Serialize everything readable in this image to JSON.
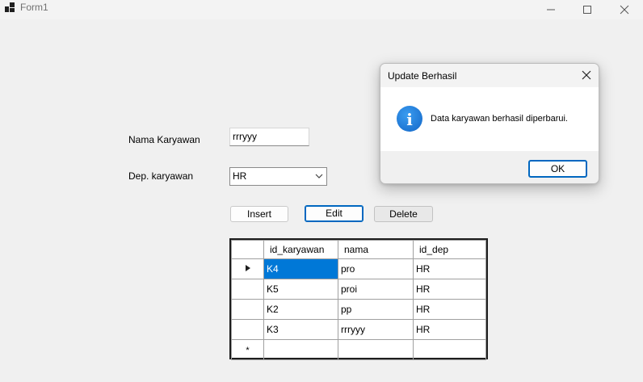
{
  "window": {
    "title": "Form1"
  },
  "form": {
    "nama_label": "Nama Karyawan",
    "nama_value": "rrryyy",
    "dep_label": "Dep. karyawan",
    "dep_value": "HR",
    "insert_label": "Insert",
    "edit_label": "Edit",
    "delete_label": "Delete"
  },
  "grid": {
    "columns": [
      "id_karyawan",
      "nama",
      "id_dep"
    ],
    "rows": [
      {
        "id_karyawan": "K4",
        "nama": "pro",
        "id_dep": "HR",
        "selected": true
      },
      {
        "id_karyawan": "K5",
        "nama": "proi",
        "id_dep": "HR"
      },
      {
        "id_karyawan": "K2",
        "nama": "pp",
        "id_dep": "HR"
      },
      {
        "id_karyawan": "K3",
        "nama": "rrryyy",
        "id_dep": "HR"
      }
    ],
    "current_row_marker": "▶",
    "new_row_marker": "*"
  },
  "dialog": {
    "title": "Update Berhasil",
    "message": "Data karyawan berhasil diperbarui.",
    "ok_label": "OK",
    "icon": "info-icon",
    "icon_glyph": "i"
  },
  "colors": {
    "selection": "#0078d7",
    "accent": "#0067c0"
  }
}
